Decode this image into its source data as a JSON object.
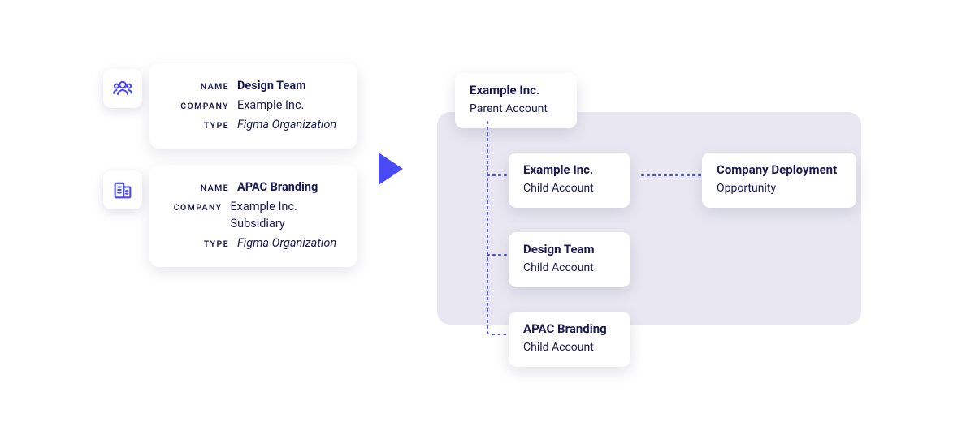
{
  "source_cards": [
    {
      "icon": "team-icon",
      "name_label": "NAME",
      "name": "Design Team",
      "company_label": "COMPANY",
      "company": "Example Inc.",
      "type_label": "TYPE",
      "type": "Figma Organization"
    },
    {
      "icon": "building-icon",
      "name_label": "NAME",
      "name": "APAC Branding",
      "company_label": "COMPANY",
      "company": "Example Inc. Subsidiary",
      "type_label": "TYPE",
      "type": "Figma Organization"
    }
  ],
  "tree": {
    "parent": {
      "title": "Example Inc.",
      "subtitle": "Parent Account"
    },
    "children": [
      {
        "title": "Example Inc.",
        "subtitle": "Child Account"
      },
      {
        "title": "Design Team",
        "subtitle": "Child Account"
      },
      {
        "title": "APAC Branding",
        "subtitle": "Child Account"
      }
    ],
    "opportunity": {
      "title": "Company Deployment",
      "subtitle": "Opportunity"
    }
  },
  "colors": {
    "text": "#1a1a52",
    "accent": "#4a4af4",
    "panel": "#e9e8f2"
  }
}
